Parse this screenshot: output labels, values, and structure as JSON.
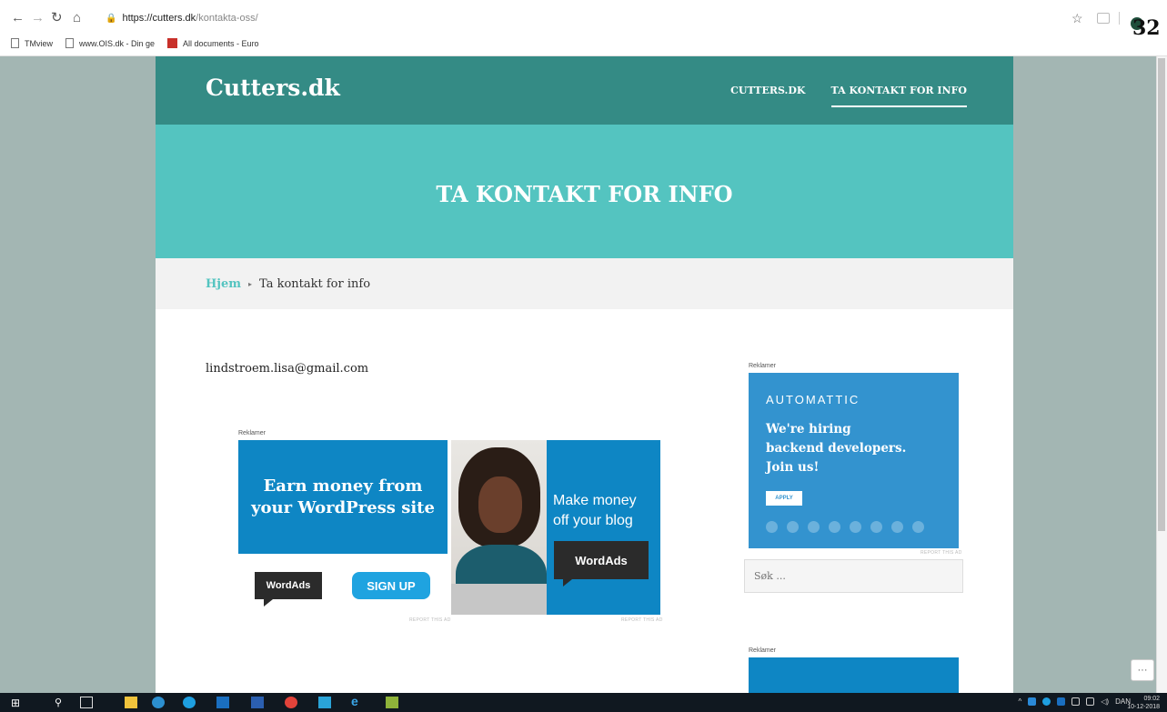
{
  "browser": {
    "url_host": "https://cutters.dk",
    "url_path": "/kontakta-oss/",
    "badge_number": "32",
    "bookmarks": [
      "TMview",
      "www.OIS.dk - Din ge",
      "All documents - Euro"
    ]
  },
  "site": {
    "title": "Cutters.dk",
    "nav": [
      "CUTTERS.DK",
      "TA KONTAKT FOR INFO"
    ],
    "hero_title": "TA KONTAKT FOR INFO",
    "breadcrumb": {
      "home": "Hjem",
      "current": "Ta kontakt for info"
    },
    "email": "lindstroem.lisa@gmail.com",
    "search_placeholder": "Søk ..."
  },
  "ads": {
    "label": "Reklamer",
    "report": "REPORT THIS AD",
    "wordads_left": {
      "headline_line1": "Earn money from",
      "headline_line2": "your WordPress site",
      "logo": "WordAds",
      "cta": "SIGN UP"
    },
    "wordads_right": {
      "line1": "Make money",
      "line2": "off your blog",
      "logo": "WordAds"
    },
    "automattic": {
      "brand": "AUTOMATTIC",
      "line1": "We're hiring",
      "line2": "backend developers.",
      "line3": "Join us!",
      "cta": "APPLY"
    }
  },
  "taskbar": {
    "lang": "DAN",
    "time": "09:02",
    "date": "10-12-2018"
  },
  "colors": {
    "header": "#348b85",
    "hero": "#54c4c0",
    "page_bg": "#a3b6b3",
    "ad_blue": "#0e86c4"
  }
}
